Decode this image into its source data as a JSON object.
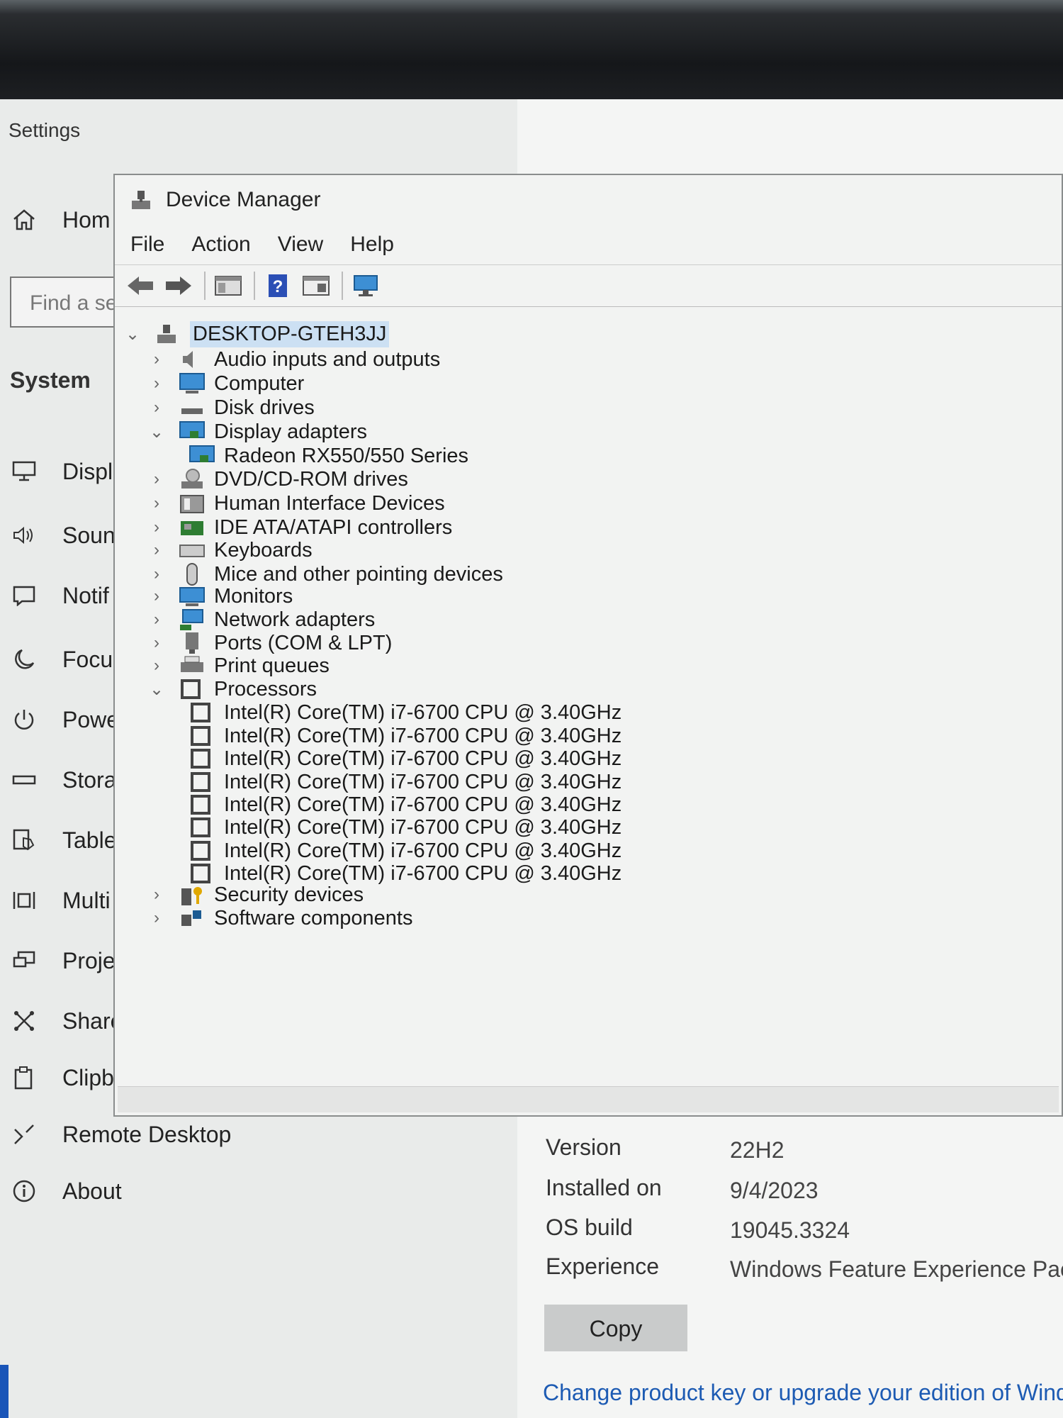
{
  "settings": {
    "title": "Settings",
    "home_label": "Hom",
    "search_placeholder": "Find a se",
    "section_heading": "System",
    "sidebar": [
      {
        "label": "Displ",
        "icon": "display-icon"
      },
      {
        "label": "Soun",
        "icon": "sound-icon"
      },
      {
        "label": "Notif",
        "icon": "notifications-icon"
      },
      {
        "label": "Focu",
        "icon": "focus-assist-icon"
      },
      {
        "label": "Powe",
        "icon": "power-icon"
      },
      {
        "label": "Stora",
        "icon": "storage-icon"
      },
      {
        "label": "Table",
        "icon": "tablet-icon"
      },
      {
        "label": "Multi",
        "icon": "multitasking-icon"
      },
      {
        "label": "Proje",
        "icon": "projecting-icon"
      },
      {
        "label": "Shared experiences",
        "icon": "shared-experiences-icon"
      },
      {
        "label": "Clipboard",
        "icon": "clipboard-icon"
      },
      {
        "label": "Remote Desktop",
        "icon": "remote-desktop-icon"
      },
      {
        "label": "About",
        "icon": "about-icon"
      }
    ],
    "specs": [
      {
        "label": "Version",
        "value": "22H2"
      },
      {
        "label": "Installed on",
        "value": "9/4/2023"
      },
      {
        "label": "OS build",
        "value": "19045.3324"
      },
      {
        "label": "Experience",
        "value": "Windows Feature Experience Pack"
      }
    ],
    "copy_label": "Copy",
    "change_link": "Change product key or upgrade your edition of Wind"
  },
  "device_manager": {
    "title": "Device Manager",
    "menu": [
      "File",
      "Action",
      "View",
      "Help"
    ],
    "root": "DESKTOP-GTEH3JJ",
    "categories": [
      {
        "label": "Audio inputs and outputs",
        "expanded": false
      },
      {
        "label": "Computer",
        "expanded": false
      },
      {
        "label": "Disk drives",
        "expanded": false
      },
      {
        "label": "Display adapters",
        "expanded": true
      },
      {
        "label": "Radeon RX550/550 Series",
        "child": true
      },
      {
        "label": "DVD/CD-ROM drives",
        "expanded": false
      },
      {
        "label": "Human Interface Devices",
        "expanded": false
      },
      {
        "label": "IDE ATA/ATAPI controllers",
        "expanded": false
      },
      {
        "label": "Keyboards",
        "expanded": false
      },
      {
        "label": "Mice and other pointing devices",
        "expanded": false
      },
      {
        "label": "Monitors",
        "expanded": false
      },
      {
        "label": "Network adapters",
        "expanded": false
      },
      {
        "label": "Ports (COM & LPT)",
        "expanded": false
      },
      {
        "label": "Print queues",
        "expanded": false
      },
      {
        "label": "Processors",
        "expanded": true
      },
      {
        "label": "Intel(R) Core(TM) i7-6700 CPU @ 3.40GHz",
        "child": true
      },
      {
        "label": "Intel(R) Core(TM) i7-6700 CPU @ 3.40GHz",
        "child": true
      },
      {
        "label": "Intel(R) Core(TM) i7-6700 CPU @ 3.40GHz",
        "child": true
      },
      {
        "label": "Intel(R) Core(TM) i7-6700 CPU @ 3.40GHz",
        "child": true
      },
      {
        "label": "Intel(R) Core(TM) i7-6700 CPU @ 3.40GHz",
        "child": true
      },
      {
        "label": "Intel(R) Core(TM) i7-6700 CPU @ 3.40GHz",
        "child": true
      },
      {
        "label": "Intel(R) Core(TM) i7-6700 CPU @ 3.40GHz",
        "child": true
      },
      {
        "label": "Intel(R) Core(TM) i7-6700 CPU @ 3.40GHz",
        "child": true
      },
      {
        "label": "Security devices",
        "expanded": false
      },
      {
        "label": "Software components",
        "expanded": false
      }
    ]
  }
}
